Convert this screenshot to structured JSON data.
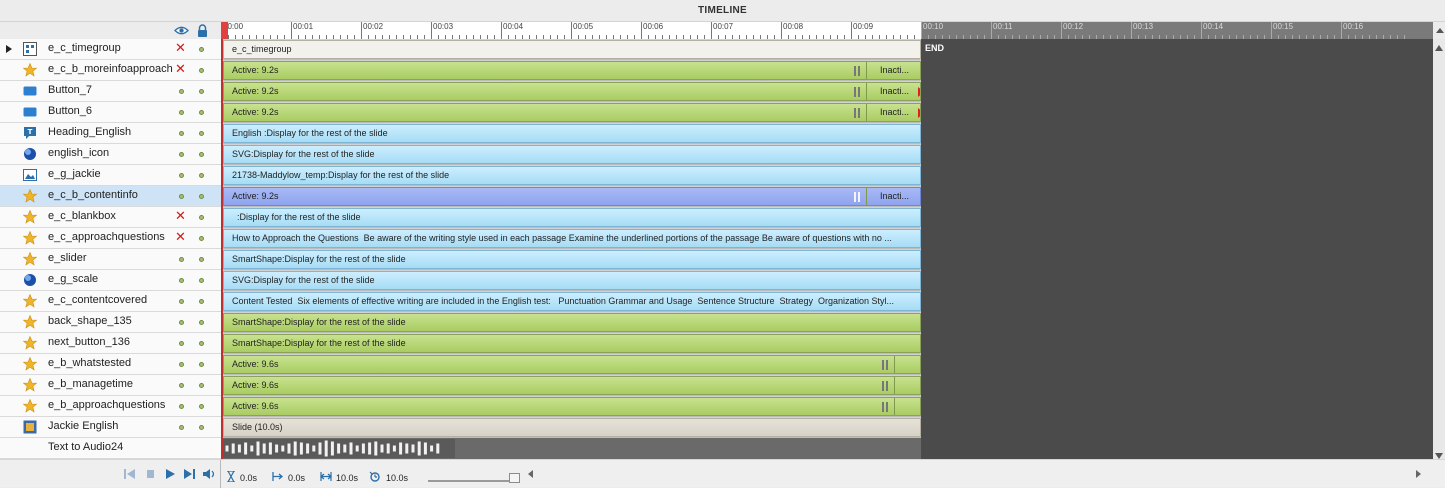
{
  "panel": {
    "title": "TIMELINE"
  },
  "ruler": {
    "active_labels": [
      "00:00",
      "00:01",
      "00:02",
      "00:03",
      "00:04",
      "00:05",
      "00:06",
      "00:07",
      "00:08",
      "00:09"
    ],
    "inactive_labels": [
      "00:10",
      "00:11",
      "00:12",
      "00:13",
      "00:14",
      "00:15",
      "00:16"
    ]
  },
  "header": {
    "eye_icon": "eye-icon",
    "lock_icon": "lock-icon"
  },
  "layers": [
    {
      "name": "e_c_timegroup",
      "icon": "group-icon",
      "hidden": true,
      "expander": true
    },
    {
      "name": "e_c_b_moreinfoapproach",
      "icon": "star-icon",
      "hidden": true
    },
    {
      "name": "Button_7",
      "icon": "button-icon",
      "hidden": false
    },
    {
      "name": "Button_6",
      "icon": "button-icon",
      "hidden": false
    },
    {
      "name": "Heading_English",
      "icon": "text-caption-icon",
      "hidden": false
    },
    {
      "name": "english_icon",
      "icon": "svg-icon",
      "hidden": false
    },
    {
      "name": "e_g_jackie",
      "icon": "image-icon",
      "hidden": false
    },
    {
      "name": "e_c_b_contentinfo",
      "icon": "star-icon",
      "hidden": false,
      "selected": true
    },
    {
      "name": "e_c_blankbox",
      "icon": "star-icon",
      "hidden": true
    },
    {
      "name": "e_c_approachquestions",
      "icon": "star-icon",
      "hidden": true
    },
    {
      "name": "e_slider",
      "icon": "star-icon",
      "hidden": false
    },
    {
      "name": "e_g_scale",
      "icon": "svg-icon",
      "hidden": false
    },
    {
      "name": "e_c_contentcovered",
      "icon": "star-icon",
      "hidden": false
    },
    {
      "name": "back_shape_135",
      "icon": "star-icon",
      "hidden": false
    },
    {
      "name": "next_button_136",
      "icon": "star-icon",
      "hidden": false
    },
    {
      "name": "e_b_whatstested",
      "icon": "star-icon",
      "hidden": false
    },
    {
      "name": "e_b_managetime",
      "icon": "star-icon",
      "hidden": false
    },
    {
      "name": "e_b_approachquestions",
      "icon": "star-icon",
      "hidden": false
    },
    {
      "name": "Jackie English",
      "icon": "slide-icon",
      "hidden": false
    },
    {
      "name": "Text to Audio24",
      "icon": "",
      "hidden": false,
      "audio": true
    }
  ],
  "tracks": [
    {
      "label": "e_c_timegroup",
      "style": "group"
    },
    {
      "label": "Active: 9.2s",
      "style": "green",
      "inactive_label": "Inacti...",
      "pause": true
    },
    {
      "label": "Active: 9.2s",
      "style": "green",
      "inactive_label": "Inacti...",
      "pause": true,
      "arrow": true
    },
    {
      "label": "Active: 9.2s",
      "style": "green",
      "inactive_label": "Inacti...",
      "pause": true,
      "arrow": true
    },
    {
      "label": "English :Display for the rest of the slide",
      "style": "blue"
    },
    {
      "label": "SVG:Display for the rest of the slide",
      "style": "blue"
    },
    {
      "label": "21738-Maddylow_temp:Display for the rest of the slide",
      "style": "blue"
    },
    {
      "label": "Active: 9.2s",
      "style": "sel",
      "inactive_label": "Inacti...",
      "pause": true
    },
    {
      "label": "  :Display for the rest of the slide",
      "style": "blue"
    },
    {
      "label": "How to Approach the Questions  Be aware of the writing style used in each passage Examine the underlined portions of the passage Be aware of questions with no ...",
      "style": "blue"
    },
    {
      "label": "SmartShape:Display for the rest of the slide",
      "style": "blue"
    },
    {
      "label": "SVG:Display for the rest of the slide",
      "style": "blue"
    },
    {
      "label": "Content Tested  Six elements of effective writing are included in the English test:   Punctuation Grammar and Usage  Sentence Structure  Strategy  Organization Styl...",
      "style": "blue"
    },
    {
      "label": "SmartShape:Display for the rest of the slide",
      "style": "green"
    },
    {
      "label": "SmartShape:Display for the rest of the slide",
      "style": "green"
    },
    {
      "label": "Active: 9.6s",
      "style": "green",
      "pause_late": true
    },
    {
      "label": "Active: 9.6s",
      "style": "green",
      "pause_late": true
    },
    {
      "label": "Active: 9.6s",
      "style": "green",
      "pause_late": true
    },
    {
      "label": "Slide (10.0s)",
      "style": "slide"
    }
  ],
  "end_label": "END",
  "playback": {
    "rewind_icon": "rewind-icon",
    "stop_icon": "stop-icon",
    "play_icon": "play-icon",
    "next_icon": "next-frame-icon",
    "audio_icon": "speaker-icon"
  },
  "status": {
    "current_time": "0.0s",
    "start_time": "0.0s",
    "duration": "10.0s",
    "loop_time": "10.0s"
  }
}
